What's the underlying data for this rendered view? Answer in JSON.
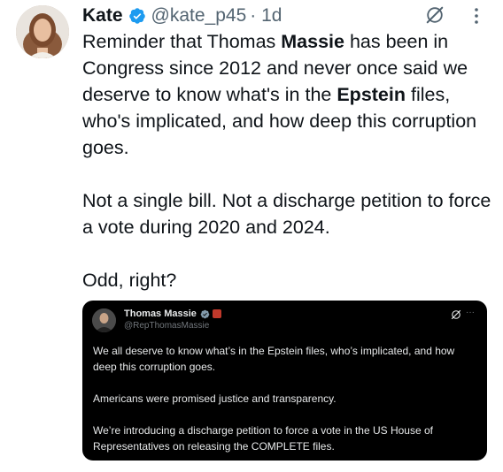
{
  "author": {
    "name": "Kate",
    "handle": "@kate_p45",
    "time": "· 1d"
  },
  "tweet": {
    "paragraph1": {
      "part1": "Reminder that Thomas ",
      "bold1": "Massie",
      "part2": " has been in Congress since 2012 and never once said we deserve to know what's in the ",
      "bold2": "Epstein",
      "part3": " files, who's implicated, and how deep this corruption goes."
    },
    "paragraph2": "Not a single bill. Not a discharge petition to force a vote during 2020 and 2024.",
    "paragraph3": "Odd, right?"
  },
  "quoted": {
    "name": "Thomas Massie",
    "handle": "@RepThomasMassie",
    "more_label": "···",
    "paragraph1": "We all deserve to know what’s in the Epstein files, who’s implicated, and how deep this corruption goes.",
    "paragraph2": "Americans were promised justice and transparency.",
    "paragraph3": "We’re introducing a discharge petition to force a vote in the US House of Representatives on releasing the COMPLETE files."
  },
  "icons": {
    "verified": "verified-badge-icon",
    "grok": "grok-icon",
    "more": "more-options-icon"
  },
  "colors": {
    "verified": "#1d9bf0",
    "text": "#0f1419",
    "secondary": "#536471",
    "quote_bg": "#000000"
  }
}
